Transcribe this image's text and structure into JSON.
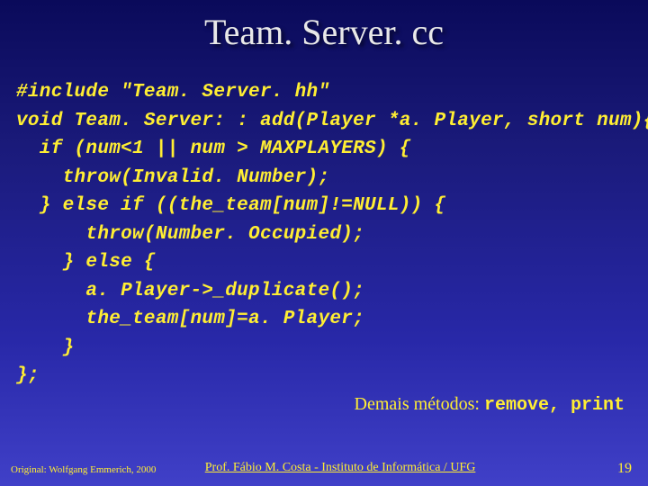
{
  "title": "Team. Server. cc",
  "code": {
    "l1": "#include \"Team. Server. hh\"",
    "l2": "void Team. Server: : add(Player *a. Player, short num){",
    "l3": "  if (num<1 || num > MAXPLAYERS) {",
    "l4": "    throw(Invalid. Number);",
    "l5": "  } else if ((the_team[num]!=NULL)) {",
    "l6": "      throw(Number. Occupied);",
    "l7": "    } else {",
    "l8": "      a. Player->_duplicate();",
    "l9": "      the_team[num]=a. Player;",
    "l10": "    }",
    "l11": "};"
  },
  "annotation": {
    "label": "Demais métodos: ",
    "methods": "remove, print"
  },
  "footer": {
    "left": "Original: Wolfgang Emmerich, 2000",
    "center": "Prof. Fábio M. Costa  -  Instituto de Informática / UFG",
    "right": "19"
  }
}
